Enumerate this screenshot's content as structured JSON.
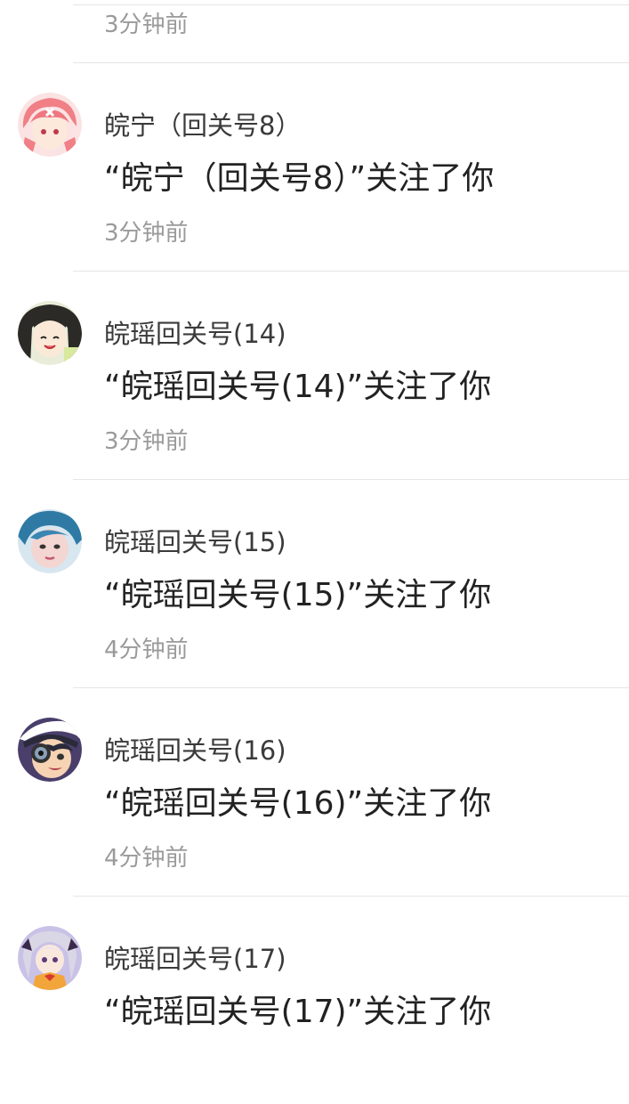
{
  "partial_item": {
    "time": "3分钟前"
  },
  "notifications": [
    {
      "username": "皖宁（回关号8）",
      "message": "“皖宁（回关号8）”关注了你",
      "time": "3分钟前",
      "avatar_icon": "anime-girl-pink-hair-avatar",
      "avatar_color": "#f28b8b"
    },
    {
      "username": "皖瑶回关号(14)",
      "message": "“皖瑶回关号(14)”关注了你",
      "time": "3分钟前",
      "avatar_icon": "anime-girl-black-hair-avatar",
      "avatar_color": "#2f3a2a"
    },
    {
      "username": "皖瑶回关号(15)",
      "message": "“皖瑶回关号(15)”关注了你",
      "time": "4分钟前",
      "avatar_icon": "blue-hair-person-avatar",
      "avatar_color": "#3a7fa8"
    },
    {
      "username": "皖瑶回关号(16)",
      "message": "“皖瑶回关号(16)”关注了你",
      "time": "4分钟前",
      "avatar_icon": "anime-boy-camera-avatar",
      "avatar_color": "#3b3560"
    },
    {
      "username": "皖瑶回关号(17)",
      "message": "“皖瑶回关号(17)”关注了你",
      "time": "",
      "avatar_icon": "anime-girl-silver-hair-avatar",
      "avatar_color": "#6b5aa0"
    }
  ]
}
